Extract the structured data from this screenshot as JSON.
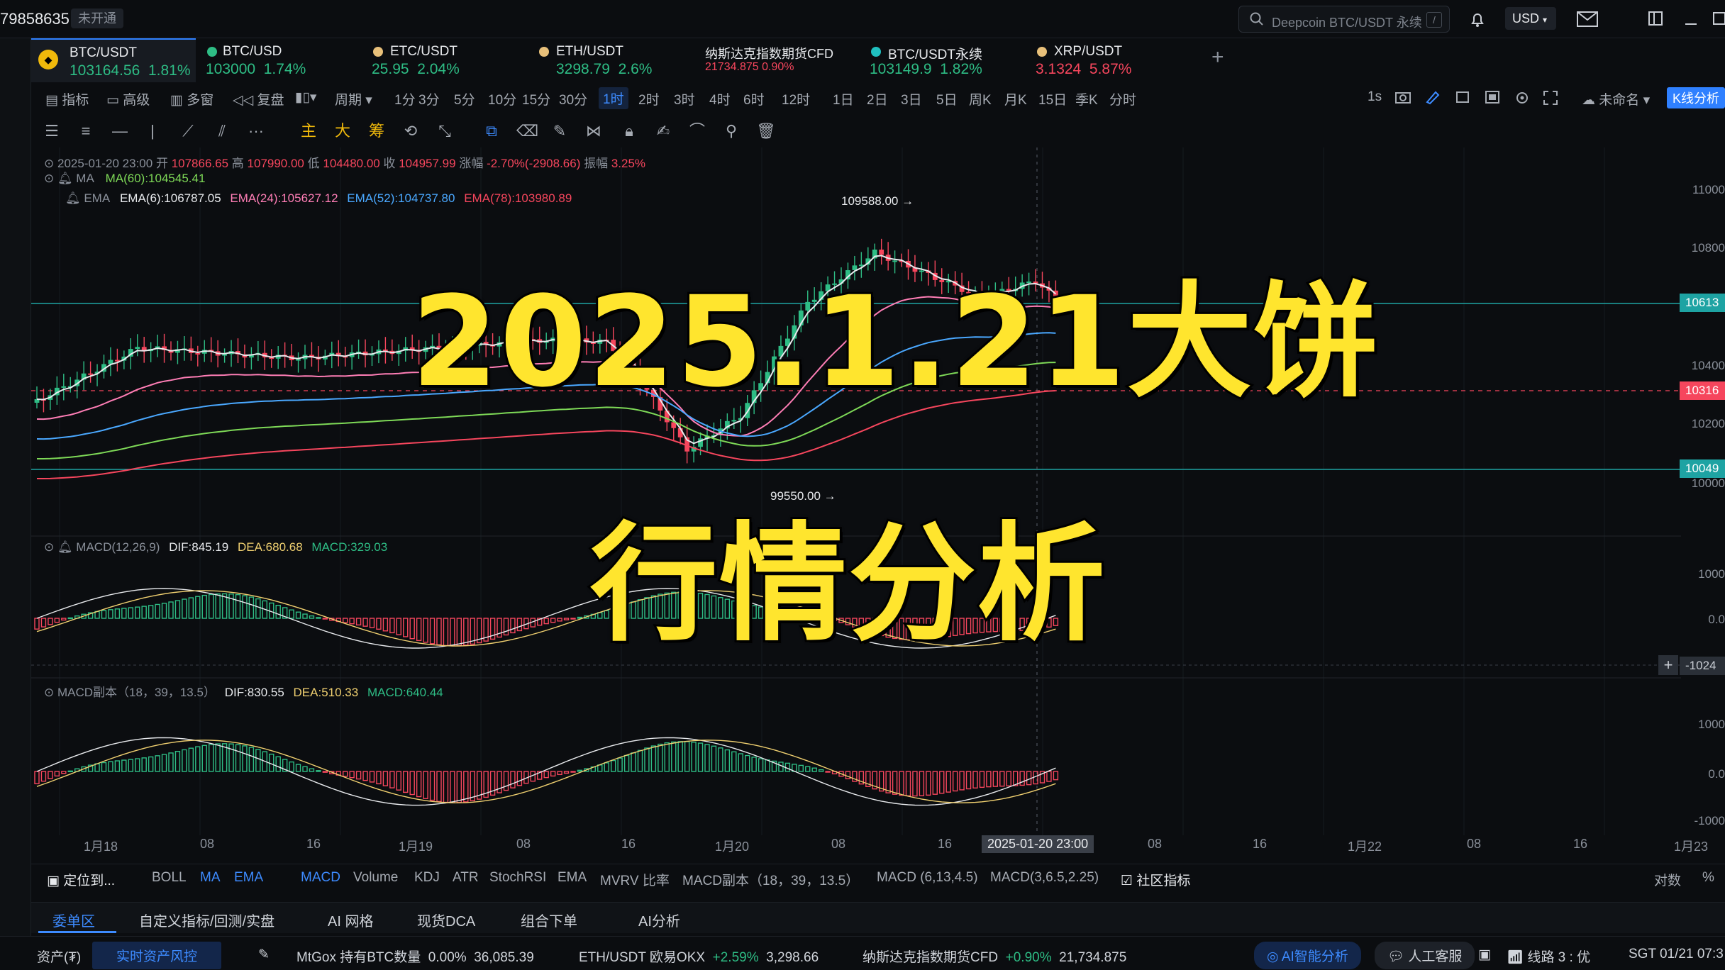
{
  "account": {
    "id": "79858635",
    "status": "未开通"
  },
  "search": {
    "placeholder": "Deepcoin BTC/USDT 永续",
    "shortcut": "/"
  },
  "currency": "USD",
  "tabs": [
    {
      "name": "BTC/USDT",
      "price": "103164.56",
      "change": "1.81%",
      "dir": "up",
      "color": "#f0b90b"
    },
    {
      "name": "BTC/USD",
      "price": "103000",
      "change": "1.74%",
      "dir": "up",
      "color": "#2ebd85"
    },
    {
      "name": "ETC/USDT",
      "price": "25.95",
      "change": "2.04%",
      "dir": "up",
      "color": "#e8c07a"
    },
    {
      "name": "ETH/USDT",
      "price": "3298.79",
      "change": "2.6%",
      "dir": "up",
      "color": "#e8c07a"
    },
    {
      "name": "纳斯达克指数期货CFD",
      "price": "21734.875",
      "change": "0.90%",
      "dir": "down",
      "color": ""
    },
    {
      "name": "BTC/USDT永续",
      "price": "103149.9",
      "change": "1.82%",
      "dir": "up",
      "color": "#20c0c0"
    },
    {
      "name": "XRP/USDT",
      "price": "3.1324",
      "change": "5.87%",
      "dir": "down",
      "color": "#e8c07a"
    }
  ],
  "toolbar": {
    "tools": [
      "指标",
      "高级",
      "多窗",
      "复盘",
      "周期"
    ],
    "timeframes": [
      "1分",
      "3分",
      "5分",
      "10分",
      "15分",
      "30分",
      "1时",
      "2时",
      "3时",
      "4时",
      "6时",
      "12时",
      "1日",
      "2日",
      "3日",
      "5日",
      "周K",
      "月K",
      "15日",
      "季K",
      "分时"
    ],
    "selected_timeframe": "1时",
    "right": {
      "interval": "1s",
      "layout_name": "未命名",
      "kline_analysis": "K线分析"
    },
    "draw_text": [
      "主",
      "大",
      "筹"
    ]
  },
  "ohlc": {
    "datetime": "2025-01-20 23:00",
    "open_label": "开",
    "open": "107866.65",
    "high_label": "高",
    "high": "107990.00",
    "low_label": "低",
    "low": "104480.00",
    "close_label": "收",
    "close": "104957.99",
    "change_label": "涨幅",
    "change": "-2.70%(-2908.66)",
    "amp_label": "振幅",
    "amp": "3.25%"
  },
  "ma_line": {
    "label": "MA",
    "ma60": "MA(60):104545.41"
  },
  "ema_line": {
    "label": "EMA",
    "e6": "EMA(6):106787.05",
    "e24": "EMA(24):105627.12",
    "e52": "EMA(52):104737.80",
    "e78": "EMA(78):103980.89"
  },
  "macd1": {
    "label": "MACD(12,26,9)",
    "dif": "DIF:845.19",
    "dea": "DEA:680.68",
    "macd": "MACD:329.03"
  },
  "macd2": {
    "label": "MACD副本（18，39，13.5）",
    "dif": "DIF:830.55",
    "dea": "DEA:510.33",
    "macd": "MACD:640.44"
  },
  "annotations": {
    "high": "109588.00",
    "low": "99550.00",
    "crosshair_time": "2025-01-20 23:00"
  },
  "price_axis": [
    "11000",
    "10800",
    "10400",
    "10200",
    "10000"
  ],
  "price_tags": [
    {
      "label": "10613",
      "color": "#1ea3a3"
    },
    {
      "label": "10316",
      "color": "#f6465d"
    },
    {
      "label": "10049",
      "color": "#1ea3a3"
    }
  ],
  "macd_axis": [
    "1000",
    "0.0"
  ],
  "macd_tag": "-1024",
  "macd2_axis": [
    "1000",
    "0.0",
    "-1000"
  ],
  "time_axis": [
    "1月18",
    "08",
    "16",
    "1月19",
    "08",
    "16",
    "1月20",
    "08",
    "16",
    "08",
    "16",
    "1月22",
    "08",
    "16",
    "1月23"
  ],
  "overlay": {
    "line1": "2025.1.21大饼",
    "line2": "行情分析"
  },
  "indicators": {
    "locate": "定位到...",
    "main": [
      "BOLL",
      "MA",
      "EMA"
    ],
    "sub": [
      "MACD",
      "Volume",
      "KDJ",
      "ATR",
      "StochRSI",
      "EMA",
      "MVRV 比率",
      "MACD副本（18，39，13.5）",
      "MACD (6,13,4.5)",
      "MACD(3,6.5,2.25)"
    ],
    "community": "社区指标",
    "right": [
      "对数",
      "%"
    ]
  },
  "panel_tabs": [
    "委单区",
    "自定义指标/回测/实盘",
    "AI 网格",
    "现货DCA",
    "组合下单",
    "AI分析"
  ],
  "status": {
    "assets": "资产(₮)",
    "risk": "实时资产风控",
    "mtgox": "MtGox 持有BTC数量",
    "mtgox_pct": "0.00%",
    "mtgox_val": "36,085.39",
    "eth": "ETH/USDT 欧易OKX",
    "eth_pct": "+2.59%",
    "eth_val": "3,298.66",
    "nas": "纳斯达克指数期货CFD",
    "nas_pct": "+0.90%",
    "nas_val": "21,734.875",
    "ai": "AI智能分析",
    "service": "人工客服",
    "line": "线路 3 : 优",
    "time": "SGT 01/21 07:3"
  },
  "chart_data": {
    "type": "candlestick",
    "timeframe": "1时",
    "price_annotations": {
      "high": 109588.0,
      "low": 99550.0
    },
    "selected_candle": {
      "time": "2025-01-20 23:00",
      "open": 107866.65,
      "high": 107990.0,
      "low": 104480.0,
      "close": 104957.99
    }
  }
}
